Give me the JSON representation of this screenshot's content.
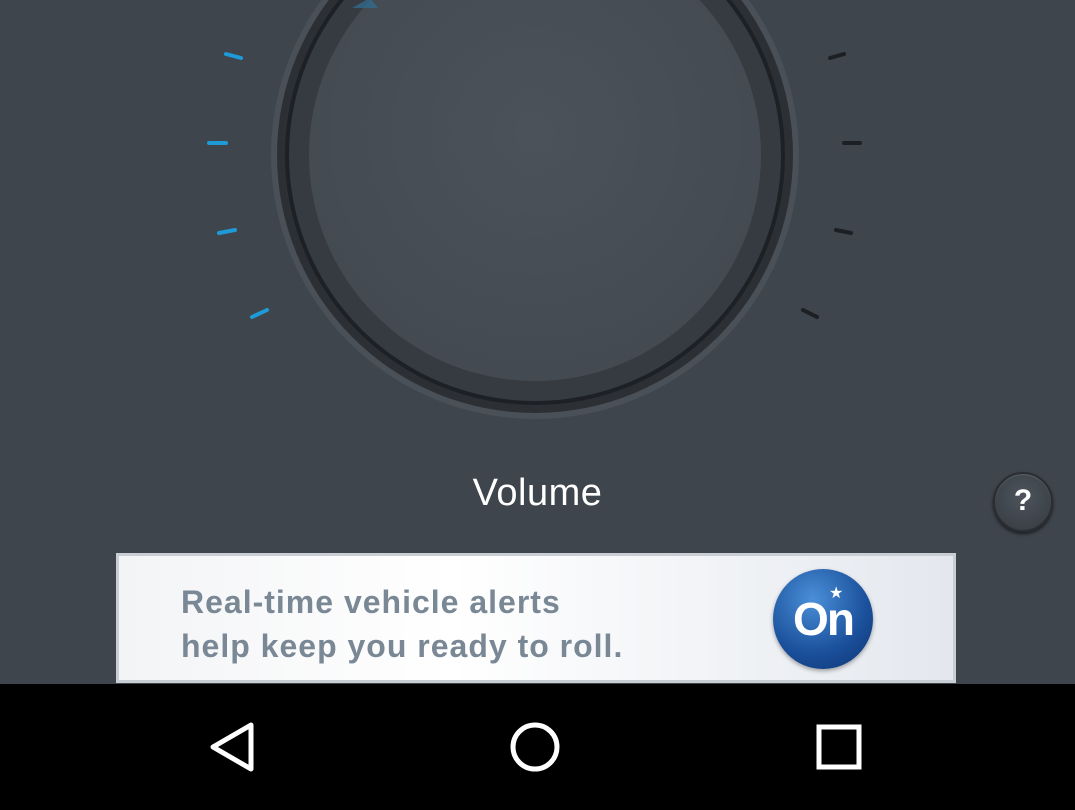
{
  "dial": {
    "label": "Volume",
    "active_color": "#1e9ad6",
    "inactive_color": "#1c1f23"
  },
  "help": {
    "label": "?"
  },
  "ad": {
    "text_line1": "Real-time vehicle alerts",
    "text_line2": "help keep you ready to roll.",
    "logo_text": "On",
    "logo_star": "★"
  },
  "nav": {
    "back": "back-icon",
    "home": "home-icon",
    "recents": "recents-icon"
  }
}
